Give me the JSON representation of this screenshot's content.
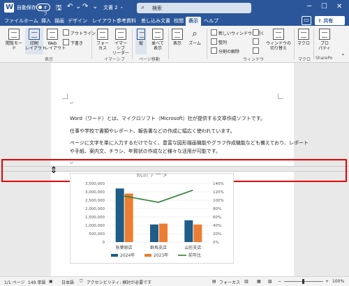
{
  "titlebar": {
    "autosave_label": "自動保存",
    "autosave_state": "オフ",
    "doc_title": "文書 2 ・",
    "search_placeholder": "検索"
  },
  "tabs": [
    "ファイル",
    "ホーム",
    "挿入",
    "描画",
    "デザイン",
    "レイアウト",
    "参考資料",
    "差し込み文書",
    "校閲",
    "表示",
    "ヘルプ"
  ],
  "share_label": "共有",
  "ribbon": {
    "views": {
      "read_mode": "閲覧モード",
      "print_layout": "印刷\nレイアウト",
      "web_layout": "Web\nレイアウト",
      "outline": "アウトライン",
      "draft": "下書き",
      "group_label": "表示"
    },
    "immersive": {
      "focus": "フォー\nカス",
      "immersive_reader": "イマー\nシブ\nリーダー",
      "group_label": "イマーシブ"
    },
    "page_movement": {
      "vertical": "縦",
      "side_to_side": "並べて\n表示",
      "group_label": "ページ移動"
    },
    "show": {
      "label": "表示"
    },
    "zoom": {
      "label": "ズーム"
    },
    "window": {
      "new_window": "新しいウィンドウを開く",
      "arrange_all": "整列",
      "split": "分割の解除",
      "switch_windows": "ウィンドウの\n切り替え",
      "group_label": "ウィンドウ"
    },
    "macros": {
      "label": "マクロ",
      "group_label": "マクロ"
    },
    "properties": {
      "label": "プロ\nパティ",
      "group_label": "SharePo"
    }
  },
  "document": {
    "paragraphs": [
      "Word（ワード）とは、マイクロソフト（Microsoft）社が提供する文章作成ソフトです。",
      "仕事や学校で書類やレポート、報告書などの作成に幅広く使われています。",
      "ページに文字を単に入力するだけでなく、豊富な図形描画機能やグラフ作成機能なども備えており、レポート",
      "や手紙、案内文、チラシ、年賀状の作成など様々な活用が可能です。"
    ],
    "para_mark": "↵"
  },
  "chart_data": {
    "type": "bar",
    "title": "統計データ",
    "categories": [
      "秋葉原店",
      "群馬支店",
      "山形支店"
    ],
    "series": [
      {
        "name": "2024年",
        "values": [
          3200000,
          1050000,
          1300000
        ],
        "color": "#1f5c87"
      },
      {
        "name": "2023年",
        "values": [
          2900000,
          1100000,
          1050000
        ],
        "color": "#ed7d31"
      }
    ],
    "line_series": {
      "name": "前年比",
      "values": [
        110,
        95,
        124
      ],
      "color": "#2e7d32",
      "axis": "right"
    },
    "yticks_left": [
      "3,500,000",
      "3,000,000",
      "2,500,000",
      "2,000,000",
      "1,500,000",
      "1,000,000",
      "500,000",
      "0"
    ],
    "yticks_right": [
      "140%",
      "120%",
      "100%",
      "80%",
      "60%",
      "40%",
      "20%",
      "0%"
    ],
    "ylim": [
      0,
      3500000
    ],
    "ylim_right": [
      0,
      140
    ],
    "legend_position": "bottom",
    "grid": true
  },
  "statusbar": {
    "page": "1/1 ページ",
    "words": "149 単語",
    "language": "日本語",
    "accessibility": "アクセシビリティ: 検討が必要です",
    "focus": "フォーカス",
    "zoom": "100%"
  },
  "colors": {
    "brand": "#2b579a",
    "highlight": "#e60000"
  }
}
